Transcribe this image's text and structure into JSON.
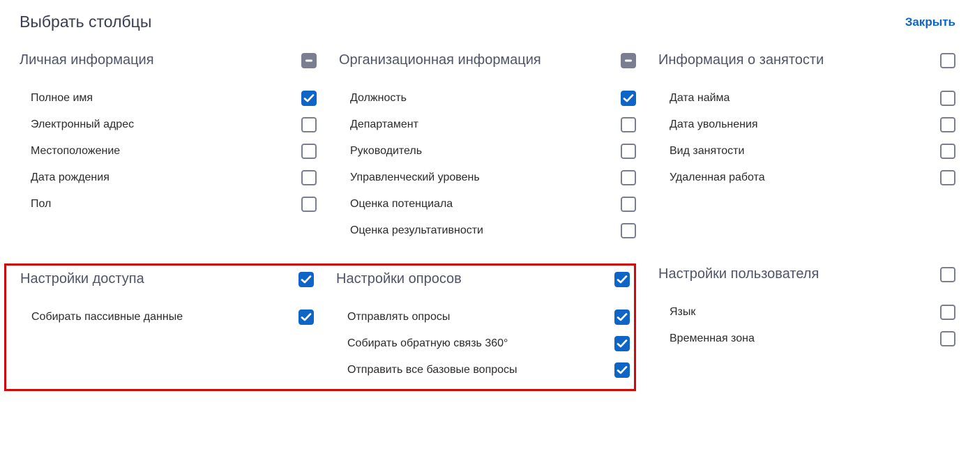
{
  "header": {
    "title": "Выбрать столбцы",
    "close": "Закрыть"
  },
  "sections": {
    "personal": {
      "title": "Личная информация",
      "state": "indeterminate",
      "items": [
        {
          "label": "Полное имя",
          "state": "checked"
        },
        {
          "label": "Электронный адрес",
          "state": "unchecked"
        },
        {
          "label": "Местоположение",
          "state": "unchecked"
        },
        {
          "label": "Дата рождения",
          "state": "unchecked"
        },
        {
          "label": "Пол",
          "state": "unchecked"
        }
      ]
    },
    "org": {
      "title": "Организационная информация",
      "state": "indeterminate",
      "items": [
        {
          "label": "Должность",
          "state": "checked"
        },
        {
          "label": "Департамент",
          "state": "unchecked"
        },
        {
          "label": "Руководитель",
          "state": "unchecked"
        },
        {
          "label": "Управленческий уровень",
          "state": "unchecked"
        },
        {
          "label": "Оценка потенциала",
          "state": "unchecked"
        },
        {
          "label": "Оценка результативности",
          "state": "unchecked"
        }
      ]
    },
    "employment": {
      "title": "Информация о занятости",
      "state": "unchecked",
      "items": [
        {
          "label": "Дата найма",
          "state": "unchecked"
        },
        {
          "label": "Дата увольнения",
          "state": "unchecked"
        },
        {
          "label": "Вид занятости",
          "state": "unchecked"
        },
        {
          "label": "Удаленная работа",
          "state": "unchecked"
        }
      ]
    },
    "access": {
      "title": "Настройки доступа",
      "state": "checked",
      "items": [
        {
          "label": "Собирать пассивные данные",
          "state": "checked"
        }
      ]
    },
    "surveys": {
      "title": "Настройки опросов",
      "state": "checked",
      "items": [
        {
          "label": "Отправлять опросы",
          "state": "checked"
        },
        {
          "label": "Собирать обратную связь 360°",
          "state": "checked"
        },
        {
          "label": "Отправить все базовые вопросы",
          "state": "checked"
        }
      ]
    },
    "user": {
      "title": "Настройки пользователя",
      "state": "unchecked",
      "items": [
        {
          "label": "Язык",
          "state": "unchecked"
        },
        {
          "label": "Временная зона",
          "state": "unchecked"
        }
      ]
    }
  }
}
